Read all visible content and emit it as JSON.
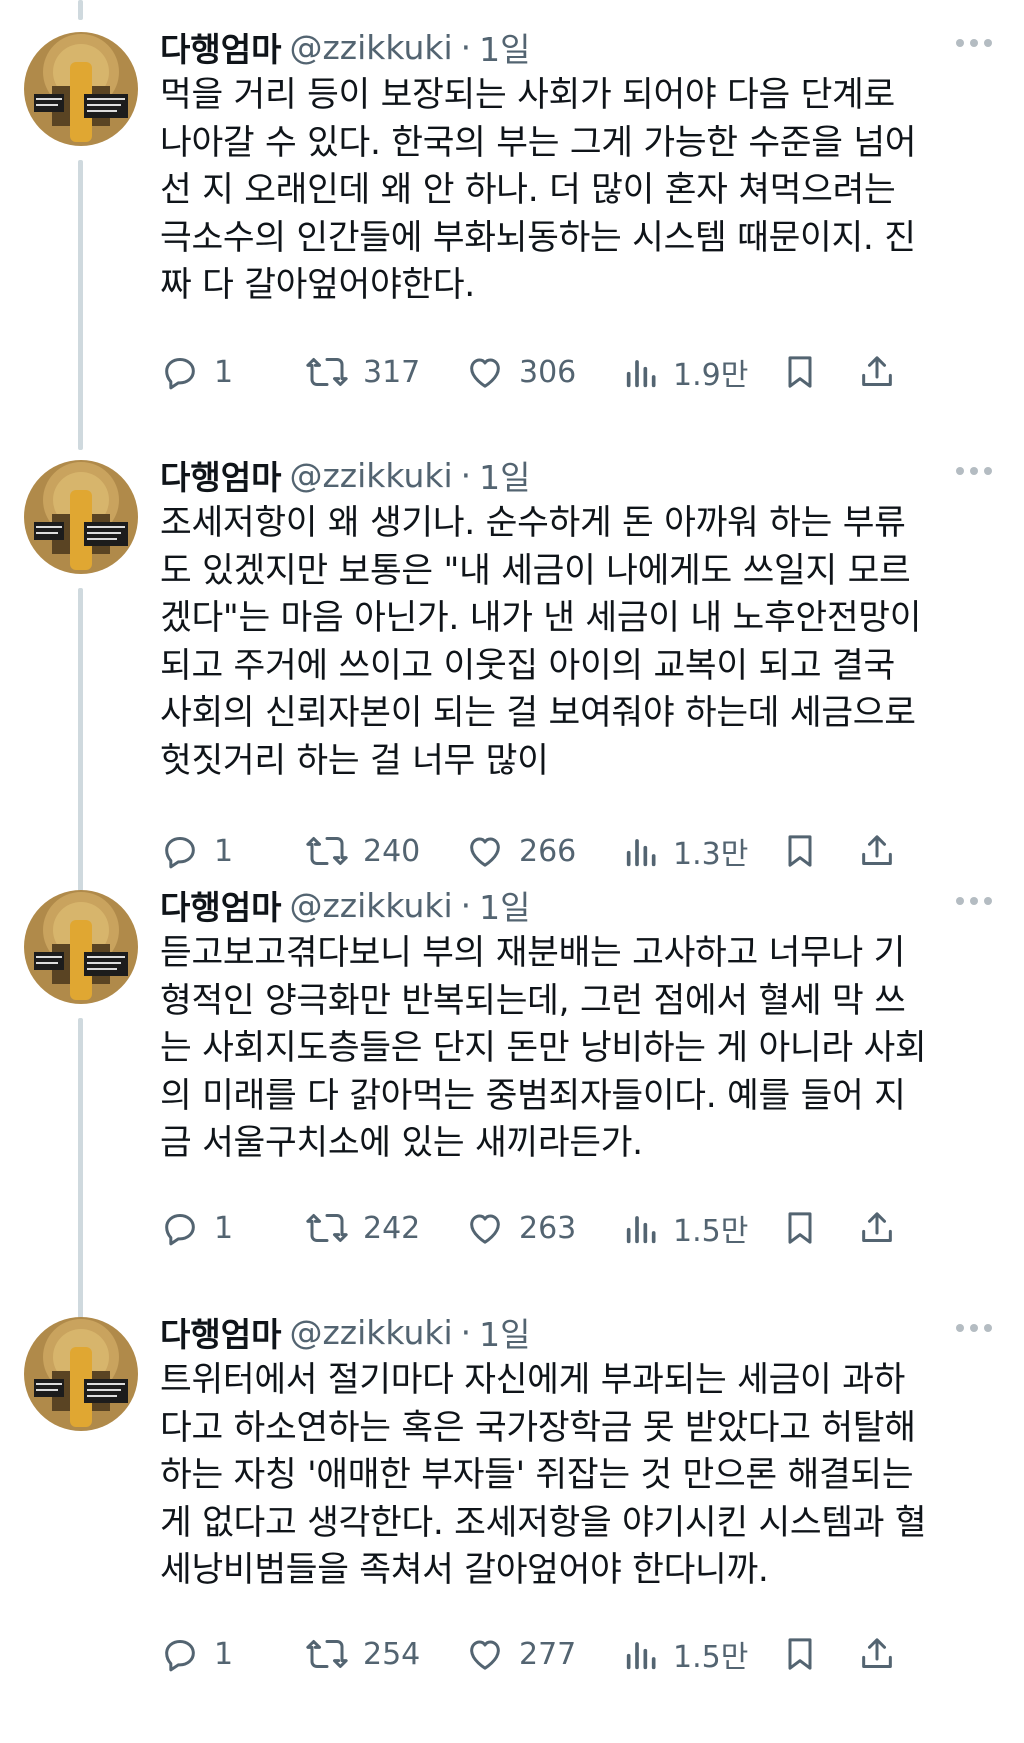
{
  "theme": {
    "text": "#0f1419",
    "secondary": "#536471",
    "thread_line": "#cfd9de",
    "icon": "#536471"
  },
  "icons": {
    "reply": "reply-icon",
    "repost": "repost-icon",
    "like": "like-icon",
    "views": "views-icon",
    "bookmark": "bookmark-icon",
    "share": "share-icon",
    "more": "more-icon"
  },
  "tweets": [
    {
      "author": {
        "name": "다행엄마",
        "handle": "@zzikkuki",
        "dot": "·",
        "time": "1일"
      },
      "lines": [
        "먹을 거리 등이 보장되는 사회가 되어야 다음 단계로",
        "나아갈 수 있다. 한국의 부는 그게 가능한 수준을 넘어",
        "선 지 오래인데 왜 안 하나. 더 많이 혼자 쳐먹으려는",
        "극소수의 인간들에 부화뇌동하는 시스템 때문이지. 진",
        "짜 다 갈아엎어야한다."
      ],
      "stats": {
        "replies": "1",
        "reposts": "317",
        "likes": "306",
        "views": "1.9만"
      }
    },
    {
      "author": {
        "name": "다행엄마",
        "handle": "@zzikkuki",
        "dot": "·",
        "time": "1일"
      },
      "lines": [
        "조세저항이 왜 생기나. 순수하게 돈 아까워 하는 부류",
        "도 있겠지만 보통은 \"내 세금이 나에게도 쓰일지 모르",
        "겠다\"는 마음 아닌가. 내가 낸 세금이 내 노후안전망이",
        "되고 주거에 쓰이고 이웃집 아이의 교복이 되고 결국",
        "사회의 신뢰자본이 되는 걸 보여줘야 하는데 세금으로",
        "헛짓거리 하는 걸 너무 많이"
      ],
      "stats": {
        "replies": "1",
        "reposts": "240",
        "likes": "266",
        "views": "1.3만"
      }
    },
    {
      "author": {
        "name": "다행엄마",
        "handle": "@zzikkuki",
        "dot": "·",
        "time": "1일"
      },
      "lines": [
        "듣고보고겪다보니 부의 재분배는 고사하고 너무나 기",
        "형적인 양극화만 반복되는데, 그런 점에서 혈세 막 쓰",
        "는 사회지도층들은 단지 돈만 낭비하는 게 아니라 사회",
        "의 미래를 다 갉아먹는 중범죄자들이다. 예를 들어 지",
        "금 서울구치소에 있는 새끼라든가."
      ],
      "stats": {
        "replies": "1",
        "reposts": "242",
        "likes": "263",
        "views": "1.5만"
      }
    },
    {
      "author": {
        "name": "다행엄마",
        "handle": "@zzikkuki",
        "dot": "·",
        "time": "1일"
      },
      "lines": [
        "트위터에서 절기마다 자신에게 부과되는 세금이 과하",
        "다고 하소연하는 혹은 국가장학금 못 받았다고 허탈해",
        "하는 자칭 '애매한 부자들' 쥐잡는 것 만으론 해결되는",
        "게 없다고 생각한다. 조세저항을 야기시킨 시스템과 혈",
        "세낭비범들을 족쳐서 갈아엎어야 한다니까."
      ],
      "stats": {
        "replies": "1",
        "reposts": "254",
        "likes": "277",
        "views": "1.5만"
      }
    }
  ]
}
